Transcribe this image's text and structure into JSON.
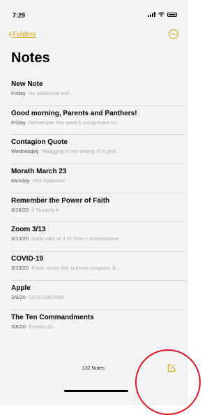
{
  "status": {
    "time": "7:29"
  },
  "nav": {
    "back_label": "Folders"
  },
  "title": "Notes",
  "notes": [
    {
      "title": "New Note",
      "date": "Friday",
      "preview": "No additional text"
    },
    {
      "title": "Good morning, Parents and Panthers!",
      "date": "Friday",
      "preview": "Remember this week's assignment fro..."
    },
    {
      "title": "Contagion Quote",
      "date": "Wednesday",
      "preview": "\"Blogging is not writing. It is graf..."
    },
    {
      "title": "Morath March 23",
      "date": "Monday",
      "preview": "353 statewide"
    },
    {
      "title": "Remember the Power of Faith",
      "date": "3/15/20",
      "preview": "2 Timothy 4"
    },
    {
      "title": "Zoom 3/13",
      "date": "3/13/20",
      "preview": "Daily calls at 3:00 from Commissioner"
    },
    {
      "title": "COVID-19",
      "date": "3/13/20",
      "preview": "Food- serve like summer program, b..."
    },
    {
      "title": "Apple",
      "date": "3/9/20",
      "preview": "042324Jb1989!"
    },
    {
      "title": "The Ten Commandments",
      "date": "3/8/20",
      "preview": "Exodus 20"
    }
  ],
  "toolbar": {
    "count": "132 Notes"
  },
  "colors": {
    "accent": "#d9a400",
    "highlight_ring": "#e0141e",
    "background": "#f4f4f6"
  },
  "icons": {
    "back": "chevron-left-icon",
    "more": "ellipsis-circle-icon",
    "compose": "compose-icon"
  }
}
